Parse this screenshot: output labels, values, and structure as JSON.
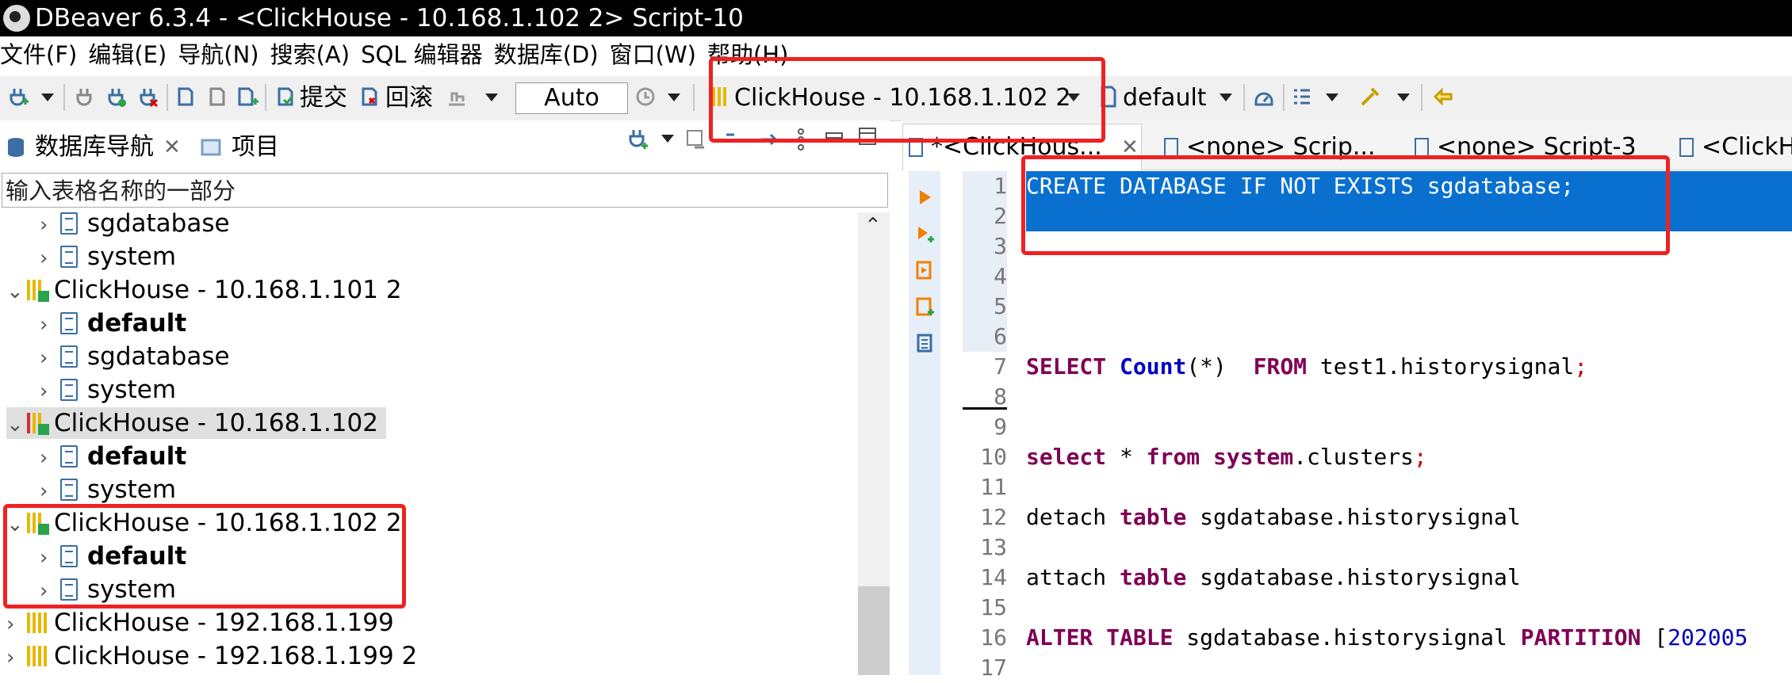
{
  "window": {
    "title": "DBeaver 6.3.4 - <ClickHouse - 10.168.1.102 2> Script-10"
  },
  "menu": [
    "文件(F)",
    "编辑(E)",
    "导航(N)",
    "搜索(A)",
    "SQL 编辑器",
    "数据库(D)",
    "窗口(W)",
    "帮助(H)"
  ],
  "toolbar": {
    "commit_label": "提交",
    "rollback_label": "回滚",
    "transaction_mode": "Auto",
    "active_connection": "ClickHouse - 10.168.1.102 2",
    "active_schema": "default"
  },
  "navigator": {
    "tab_db": "数据库导航",
    "tab_project": "项目",
    "filter_placeholder": "输入表格名称的一部分",
    "rows": [
      {
        "label": "sgdatabase"
      },
      {
        "label": "system"
      },
      {
        "label": "ClickHouse - 10.168.1.101 2"
      },
      {
        "label": "default"
      },
      {
        "label": "sgdatabase"
      },
      {
        "label": "system"
      },
      {
        "label": "ClickHouse - 10.168.1.102"
      },
      {
        "label": "default"
      },
      {
        "label": "system"
      },
      {
        "label": "ClickHouse - 10.168.1.102 2"
      },
      {
        "label": "default"
      },
      {
        "label": "system"
      },
      {
        "label": "ClickHouse - 192.168.1.199"
      },
      {
        "label": "ClickHouse - 192.168.1.199 2"
      }
    ]
  },
  "editor": {
    "tabs": [
      "*<ClickHous...",
      "<none> Scrip...",
      "<none> Script-3",
      "<ClickH"
    ],
    "line_numbers": [
      "1",
      "2",
      "3",
      "4",
      "5",
      "6",
      "7",
      "8",
      "9",
      "10",
      "11",
      "12",
      "13",
      "14",
      "15",
      "16",
      "17"
    ],
    "code": {
      "l1_kw1": "CREATE DATABASE IF NOT EXISTS",
      "l1_rest": " sgdatabase;",
      "l7_kw": "SELECT",
      "l7_fn": "Count",
      "l7_mid": "(*)  ",
      "l7_kw2": "FROM",
      "l7_rest": " test1.historysignal",
      "l7_semi": ";",
      "l10_kw": "select",
      "l10_mid": " * ",
      "l10_kw2": "from",
      "l10_sp": " ",
      "l10_kw3": "system",
      "l10_rest": ".clusters",
      "l10_semi": ";",
      "l12_a": "detach ",
      "l12_kw": "table",
      "l12_rest": " sgdatabase.historysignal",
      "l14_a": "attach ",
      "l14_kw": "table",
      "l14_rest": " sgdatabase.historysignal",
      "l16_kw": "ALTER TABLE",
      "l16_mid": " sgdatabase.historysignal ",
      "l16_kw2": "PARTITION",
      "l16_br": " [",
      "l16_num": "202005"
    }
  }
}
